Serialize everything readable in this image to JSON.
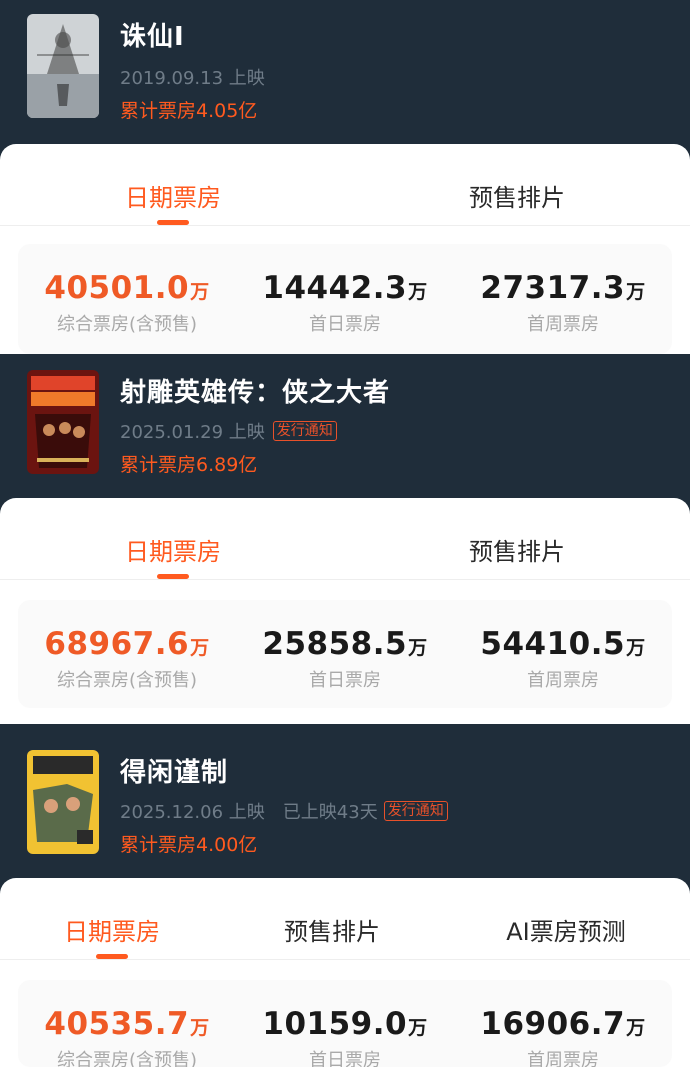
{
  "movies": [
    {
      "title": "诛仙Ⅰ",
      "poster_icon": "movie-poster-jade-dynasty",
      "release": "2019.09.13 上映",
      "showing": "",
      "badge": "",
      "total": "累计票房4.05亿",
      "tabs": [
        "日期票房",
        "预售排片"
      ],
      "active_tab": 0,
      "stats": [
        {
          "value": "40501.0",
          "unit": "万",
          "label": "综合票房(含预售)"
        },
        {
          "value": "14442.3",
          "unit": "万",
          "label": "首日票房"
        },
        {
          "value": "27317.3",
          "unit": "万",
          "label": "首周票房"
        }
      ]
    },
    {
      "title": "射雕英雄传：侠之大者",
      "poster_icon": "movie-poster-legends-of-condor-heroes",
      "release": "2025.01.29 上映",
      "showing": "",
      "badge": "发行通知",
      "total": "累计票房6.89亿",
      "tabs": [
        "日期票房",
        "预售排片"
      ],
      "active_tab": 0,
      "stats": [
        {
          "value": "68967.6",
          "unit": "万",
          "label": "综合票房(含预售)"
        },
        {
          "value": "25858.5",
          "unit": "万",
          "label": "首日票房"
        },
        {
          "value": "54410.5",
          "unit": "万",
          "label": "首周票房"
        }
      ]
    },
    {
      "title": "得闲谨制",
      "poster_icon": "movie-poster-dexian-jinzhi",
      "release": "2025.12.06 上映",
      "showing": "已上映43天",
      "badge": "发行通知",
      "total": "累计票房4.00亿",
      "tabs": [
        "日期票房",
        "预售排片",
        "AI票房预测"
      ],
      "active_tab": 0,
      "stats": [
        {
          "value": "40535.7",
          "unit": "万",
          "label": "综合票房(含预售)"
        },
        {
          "value": "10159.0",
          "unit": "万",
          "label": "首日票房"
        },
        {
          "value": "16906.7",
          "unit": "万",
          "label": "首周票房"
        }
      ]
    }
  ],
  "colors": {
    "background": "#1f2d3a",
    "accent": "#ff5a1f",
    "muted": "#6f7c88"
  }
}
